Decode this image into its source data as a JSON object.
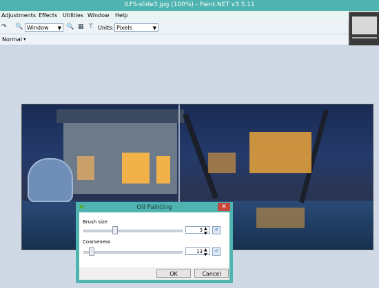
{
  "window": {
    "title": "ILFS-slide3.jpg (100%) - Paint.NET v3.5.11"
  },
  "menu": {
    "items": [
      "Adjustments",
      "Effects",
      "Utilities",
      "Window",
      "Help"
    ]
  },
  "toolbar": {
    "zoom_select": "Window",
    "units_label": "Units:",
    "units_select": "Pixels",
    "blend_mode": "Normal"
  },
  "dialog": {
    "title": "Oil Painting",
    "brush_size_label": "Brush size",
    "brush_size_value": "3",
    "coarseness_label": "Coarseness",
    "coarseness_value": "13",
    "ok_label": "OK",
    "cancel_label": "Cancel"
  },
  "colors": {
    "titlebar": "#4fb3b0",
    "close_button": "#c9463d"
  }
}
